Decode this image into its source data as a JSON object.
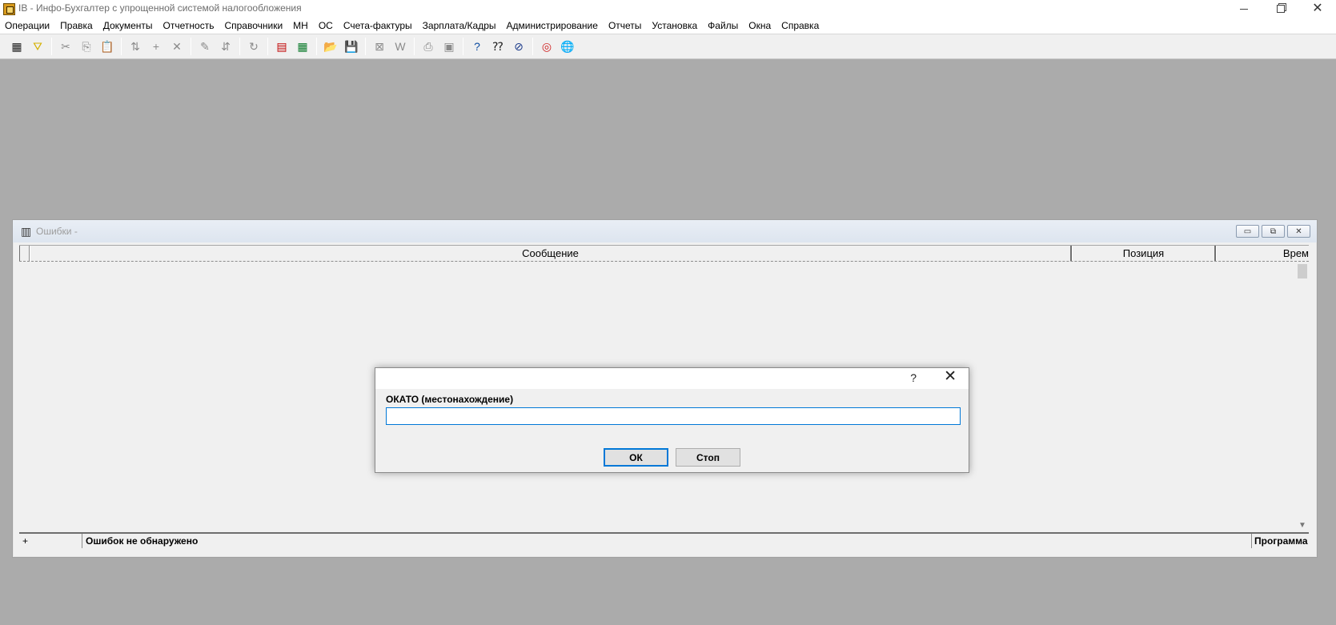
{
  "window": {
    "title": "IB - Инфо-Бухгалтер с упрощенной системой налогообложения",
    "controls": {
      "minimize": "—",
      "maximize": "❐",
      "close": "✕"
    }
  },
  "menu": {
    "items": [
      "Операции",
      "Правка",
      "Документы",
      "Отчетность",
      "Справочники",
      "МН",
      "ОС",
      "Счета-фактуры",
      "Зарплата/Кадры",
      "Администрирование",
      "Отчеты",
      "Установка",
      "Файлы",
      "Окна",
      "Справка"
    ]
  },
  "toolbar": {
    "buttons": [
      {
        "icon": "grid-icon",
        "glyph": "▦",
        "active": true
      },
      {
        "icon": "filter-icon",
        "glyph": "⛛",
        "active": true,
        "color": "#d4b000"
      },
      {
        "sep": true
      },
      {
        "icon": "cut-icon",
        "glyph": "✂",
        "active": false
      },
      {
        "icon": "copy-icon",
        "glyph": "⎘",
        "active": false
      },
      {
        "icon": "paste-icon",
        "glyph": "📋",
        "active": false
      },
      {
        "sep": true
      },
      {
        "icon": "rotate-180-icon",
        "glyph": "⇅",
        "active": false
      },
      {
        "icon": "add-icon",
        "glyph": "+",
        "active": false
      },
      {
        "icon": "delete-icon",
        "glyph": "✕",
        "active": false
      },
      {
        "sep": true
      },
      {
        "icon": "brush-icon",
        "glyph": "✎",
        "active": false
      },
      {
        "icon": "sort-icon",
        "glyph": "⇵",
        "active": false
      },
      {
        "sep": true
      },
      {
        "icon": "refresh-icon",
        "glyph": "↻",
        "active": false
      },
      {
        "sep": true
      },
      {
        "icon": "report-icon",
        "glyph": "▤",
        "active": true,
        "color": "#c00000"
      },
      {
        "icon": "calculator-icon",
        "glyph": "▦",
        "active": true,
        "color": "#0a7a2a"
      },
      {
        "sep": true
      },
      {
        "icon": "open-folder-icon",
        "glyph": "📂",
        "active": true,
        "color": "#c08a00"
      },
      {
        "icon": "save-icon",
        "glyph": "💾",
        "active": false
      },
      {
        "sep": true
      },
      {
        "icon": "excel-icon",
        "glyph": "⊠",
        "active": false
      },
      {
        "icon": "word-icon",
        "glyph": "W",
        "active": false
      },
      {
        "sep": true
      },
      {
        "icon": "print-icon",
        "glyph": "⎙",
        "active": false
      },
      {
        "icon": "preview-icon",
        "glyph": "▣",
        "active": false
      },
      {
        "sep": true
      },
      {
        "icon": "help-icon",
        "glyph": "?",
        "active": true,
        "color": "#0a4aa0"
      },
      {
        "icon": "context-help-icon",
        "glyph": "⁇",
        "active": true
      },
      {
        "icon": "compass-icon",
        "glyph": "⊘",
        "active": true,
        "color": "#1a3a8a"
      },
      {
        "sep": true
      },
      {
        "icon": "lifebuoy-icon",
        "glyph": "◎",
        "active": true,
        "color": "#d02020"
      },
      {
        "icon": "globe-icon",
        "glyph": "🌐",
        "active": true,
        "color": "#2a6ac0"
      }
    ]
  },
  "errors_window": {
    "title": "Ошибки -",
    "columns": {
      "row": "",
      "message": "Сообщение",
      "position": "Позиция",
      "time": "Врем"
    },
    "status": {
      "plus": "+",
      "message": "Ошибок не обнаружено",
      "source": "Программа"
    },
    "buttons": {
      "minimize": "▭",
      "restore": "⧉",
      "close": "✕"
    }
  },
  "dialog": {
    "help": "?",
    "close": "✕",
    "label": "ОКАТО (местонахождение)",
    "input_value": "",
    "ok_label": "ОК",
    "stop_label": "Стоп"
  }
}
